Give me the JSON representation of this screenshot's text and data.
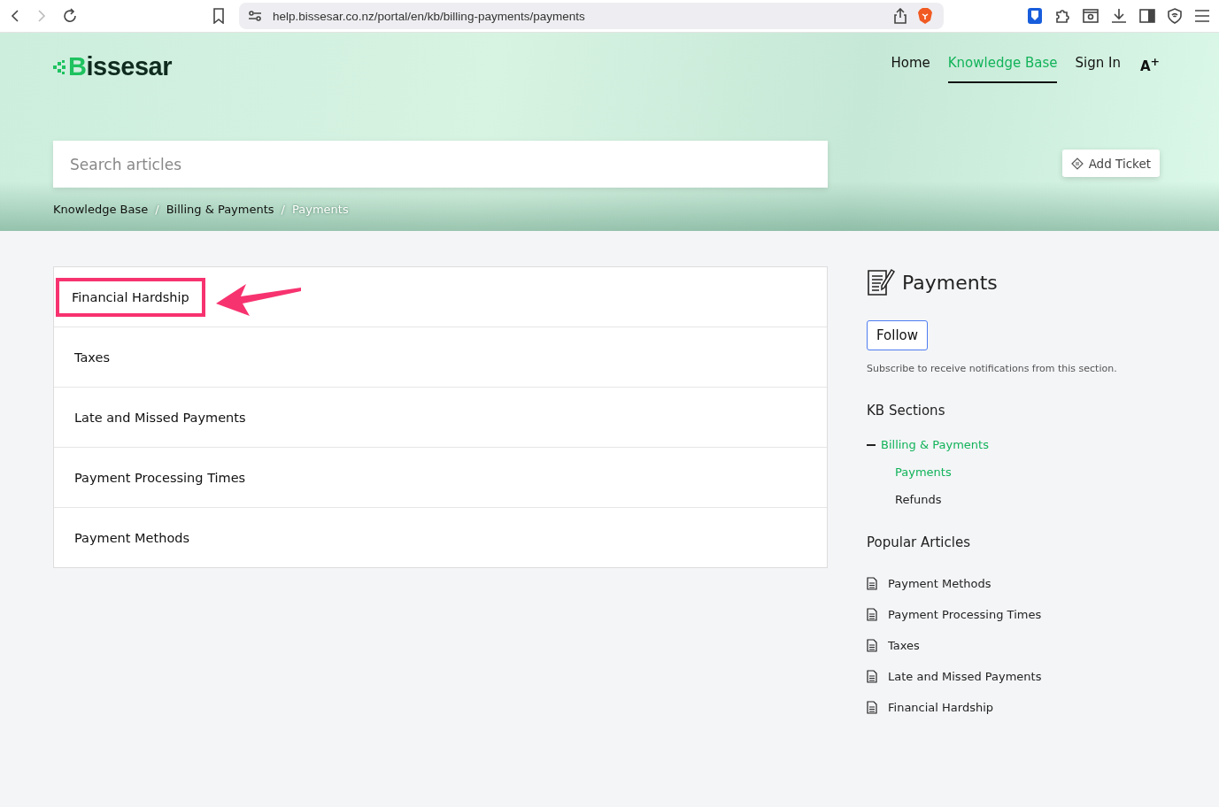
{
  "browser": {
    "url": "help.bissesar.co.nz/portal/en/kb/billing-payments/payments"
  },
  "header": {
    "logo": "Bissesar",
    "nav": [
      {
        "label": "Home",
        "selected": false
      },
      {
        "label": "Knowledge Base",
        "selected": true
      },
      {
        "label": "Sign In",
        "selected": false
      }
    ],
    "font_size_button": "A$^{+}$",
    "search": {
      "placeholder": "Search articles"
    },
    "add_ticket": "Add Ticket",
    "breadcrumbs": [
      {
        "label": "Knowledge Base",
        "current": false
      },
      {
        "separator": "/",
        "label": "Billing & Payments",
        "current": false
      },
      {
        "separator": "/",
        "label": "Payments",
        "current": true
      }
    ]
  },
  "articles": [
    {
      "title": "Financial Hardship",
      "highlighted": true
    },
    {
      "title": "Taxes",
      "highlighted": false
    },
    {
      "title": "Late and Missed Payments",
      "highlighted": false
    },
    {
      "title": "Payment Processing Times",
      "highlighted": false
    },
    {
      "title": "Payment Methods",
      "highlighted": false
    }
  ],
  "sidebar": {
    "title": "Payments",
    "follow": "Follow",
    "follow_note": "Subscribe to receive notifications from this section.",
    "sections_heading": "KB Sections",
    "sections": [
      {
        "label": "Billing & Payments",
        "expanded": true,
        "children": [
          {
            "label": "Payments",
            "selected": true
          },
          {
            "label": "Refunds",
            "selected": false
          }
        ]
      }
    ],
    "popular_heading": "Popular Articles",
    "popular": [
      "Payment Methods",
      "Payment Processing Times",
      "Taxes",
      "Late and Missed Payments",
      "Financial Hardship"
    ]
  }
}
